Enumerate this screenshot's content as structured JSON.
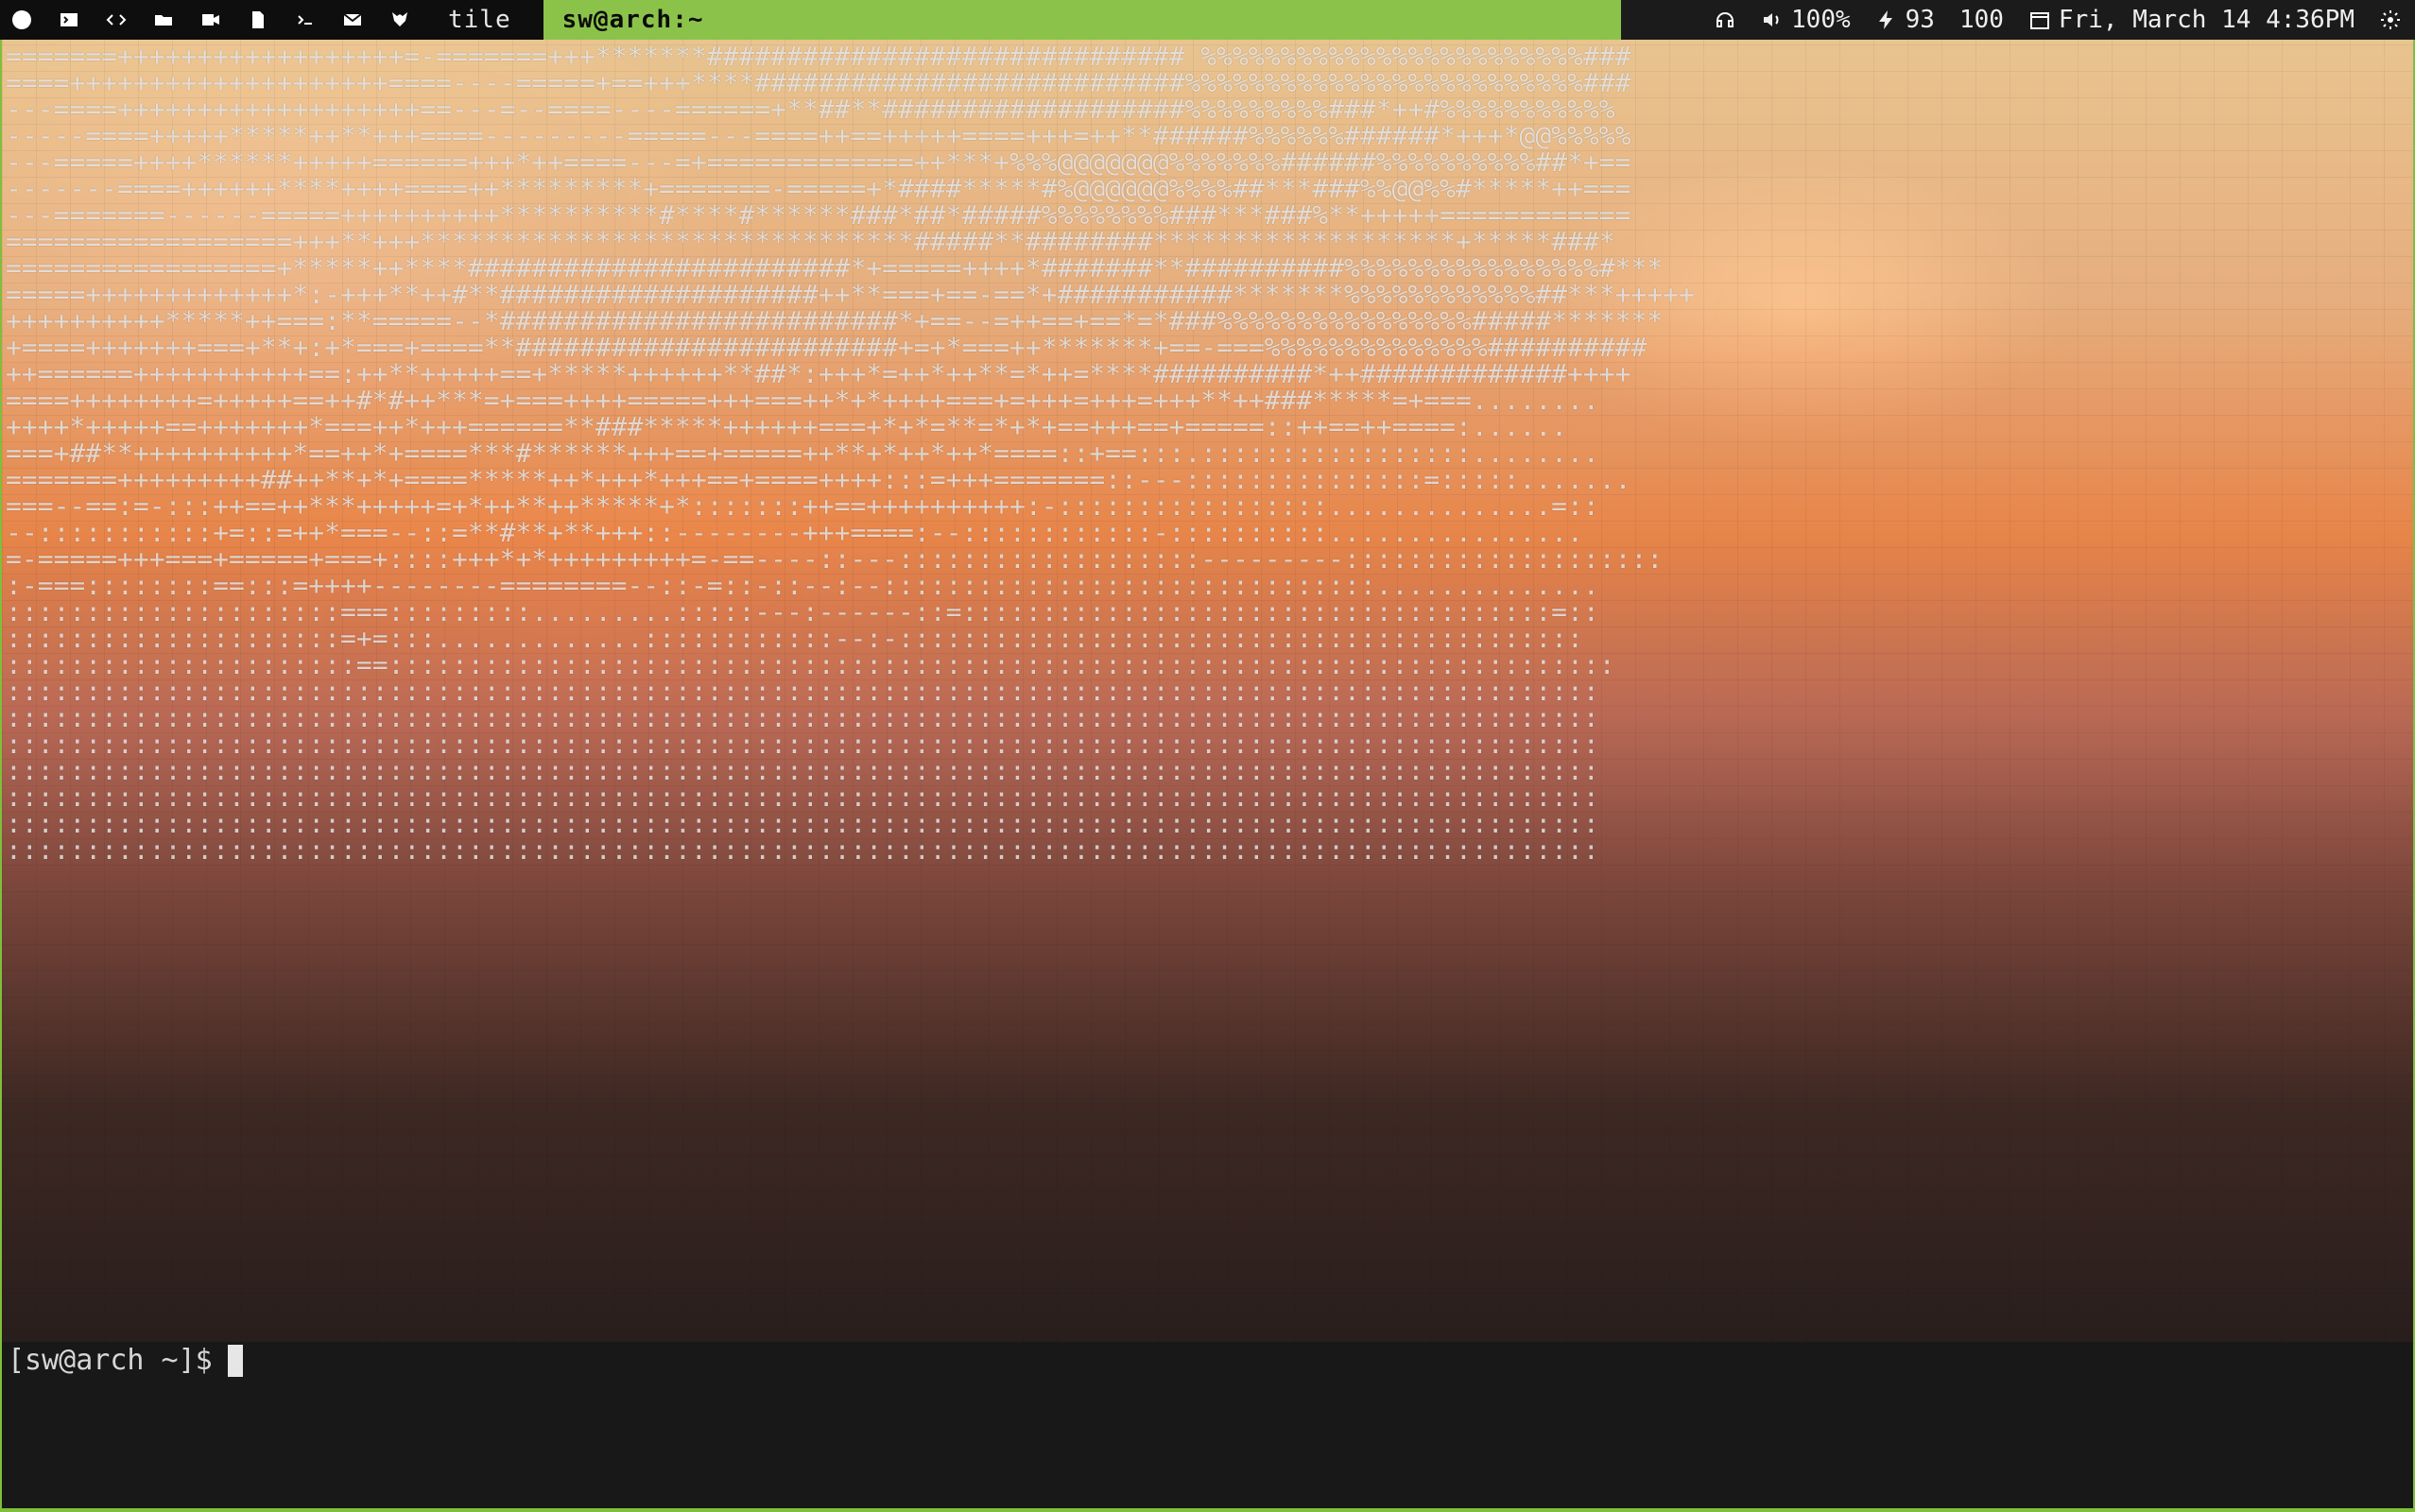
{
  "topbar": {
    "workspace": "tile",
    "window_title": "sw@arch:~",
    "volume": "100%",
    "battery": "93",
    "brightness": "100",
    "datetime": "Fri, March 14 4:36PM",
    "icons_left": [
      "app-icon",
      "terminal-icon",
      "code-icon",
      "folder-icon",
      "video-icon",
      "document-icon",
      "prompt-icon",
      "mail-icon",
      "fox-icon"
    ]
  },
  "terminal": {
    "ascii_art": "=======++++++++++++++++++=-=======+++*******############################## %%%%%%%%%%%%%%%%%%%%%%%%###\n====++++++++++++++++++++====----=====+==+++****###########################%%%%%%%%%%%%%%%%%%%%%%%%%###\n---====+++++++++++++++++++==---=--====----======+**##**###################%%%%%%%%%###*++#%%%%%%%%%%%\n-----====+++++*****++**+++====---------=====---====++==+++++====+++=++**######%%%%%%######*+++*@@%%%%%\n---=====++++******+++++======+++*++====---=+=============++***+%%%@@@@@@@%%%%%%%######%%%%%%%%%%##*+==\n-------====++++++****++++====++*********+=======-=====+*####*****#%@@@@@@%%%%##***###%%@@%%#*****++===\n---=======------=====++++++++++**********#****#******###*##*#####%%%%%%%%###***###%**+++++============\n==================+++**+++*******************************#####**########*******************+*****###*\n=================+*****++****########################*+=====++++*#######**##########%%%%%%%%%%%%%%%%#***\n=====+++++++++++++*:-+++**++#**####################++**===+==-==*+###########*******%%%%%%%%%%%%##***+++++\n++++++++++*****++===:**=====--*#########################*+==--=++==+==*=*###%%%%%%%%%%%%%%%%#####*******\n+====+++++++===+**+:+*===+====**########################+=+*===++*******+==-===%%%%%%%%%%%%%%##########\n++======+++++++++++==:++**+++++==+*****++++++**##*:+++*=++*++**=*++=****##########*++#############++++\n====++++++++=+++++==++#*#++***=+===++++=====+++===++*+*++++===+=+++=+++=+++**++###*****=+===........\n++++*+++++==+++++++*===++*+++======**###*****++++++===+*+*=**=*+*+==+++==+=====::++==++====:......\n===+##**++++++++++*==++*+====***#******+++==+=====++**+*++*++*====::+==:::.:::::::::::::::::........\n=======+++++++++##++**+*+====*****++*+++*+++==+====++++:::=+++=======::---:::::::::::::::=:::::.......\n===--==:=-:::++==++***+++++=+*++**++*****+*:::::::++==++++++++++:-:::::::::::::::::..............=::\n--:::::::::::+=::=++*===--::=**#**+**+++::--------+++====:--::::::::::::-::::::::::................\n=-=====+++===+=====+===+::::+++*+*+++++++++=-==----::---:::::::::::::::::::---------::::::::::::::::::::\n:-===::::::::==:::=++++--------========--::-=::-::--:--:::::::::::::::::::::::::::::::..............\n:::::::::::::::::::::===:::::::::.........:::::---:------::=:::::::::::::::::::::::::::::::::::::=::\n:::::::::::::::::::::=+=:::.............::::::::::::--:-:::::::::::::::::::::::::::::::::::::::::::\n::::::::::::::::::::::==:::::::::::::::::::::::::::::::::::::::::::::::::::::::::::::::::::::::::::::\n::::::::::::::::::::::::::::::::::::::::::::::::::::::::::::::::::::::::::::::::::::::::::::::::::::\n::::::::::::::::::::::::::::::::::::::::::::::::::::::::::::::::::::::::::::::::::::::::::::::::::::\n::::::::::::::::::::::::::::::::::::::::::::::::::::::::::::::::::::::::::::::::::::::::::::::::::::\n::::::::::::::::::::::::::::::::::::::::::::::::::::::::::::::::::::::::::::::::::::::::::::::::::::\n::::::::::::::::::::::::::::::::::::::::::::::::::::::::::::::::::::::::::::::::::::::::::::::::::::\n::::::::::::::::::::::::::::::::::::::::::::::::::::::::::::::::::::::::::::::::::::::::::::::::::::\n::::::::::::::::::::::::::::::::::::::::::::::::::::::::::::::::::::::::::::::::::::::::::::::::::::",
    "prompt": "[sw@arch ~]$"
  }
}
